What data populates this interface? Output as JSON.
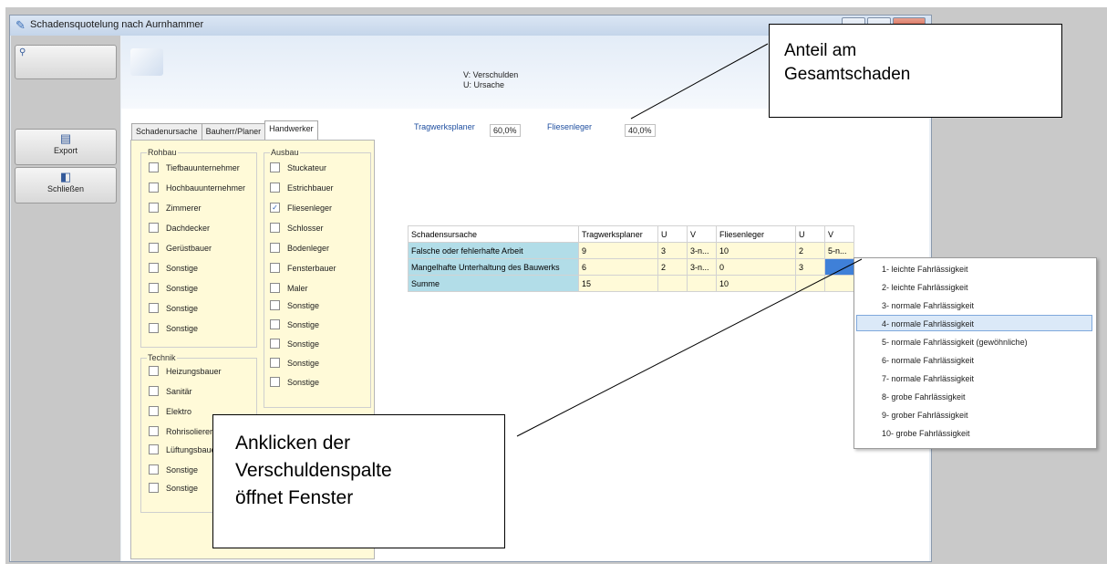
{
  "window": {
    "title": "Schadensquotelung nach Aurnhammer"
  },
  "sidebar": {
    "export_label": "Export",
    "close_label": "Schließen"
  },
  "header": {
    "legend_v": "V: Verschulden",
    "legend_u": "U: Ursache"
  },
  "tabs": [
    "Schadenursache",
    "Bauherr/Planer",
    "Handwerker"
  ],
  "groups": {
    "rohbau": {
      "title": "Rohbau",
      "items": [
        "Tiefbauunternehmer",
        "Hochbauunternehmer",
        "Zimmerer",
        "Dachdecker",
        "Gerüstbauer",
        "Sonstige",
        "Sonstige",
        "Sonstige",
        "Sonstige"
      ]
    },
    "ausbau": {
      "title": "Ausbau",
      "items": [
        "Stuckateur",
        "Estrichbauer",
        "Fliesenleger",
        "Schlosser",
        "Bodenleger",
        "Fensterbauer",
        "Maler",
        "Sonstige",
        "Sonstige",
        "Sonstige",
        "Sonstige",
        "Sonstige"
      ],
      "checked_index": 2
    },
    "technik": {
      "title": "Technik",
      "items": [
        "Heizungsbauer",
        "Sanitär",
        "Elektro",
        "Rohrisolierer",
        "Lüftungsbauer",
        "Sonstige",
        "Sonstige"
      ]
    }
  },
  "shares": [
    {
      "label": "Tragwerksplaner",
      "value": "60,0%"
    },
    {
      "label": "Fliesenleger",
      "value": "40,0%"
    }
  ],
  "table": {
    "headers": [
      "Schadensursache",
      "Tragwerksplaner",
      "U",
      "V",
      "Fliesenleger",
      "U",
      "V"
    ],
    "rows": [
      [
        "Falsche oder fehlerhafte Arbeit",
        "9",
        "3",
        "3-n...",
        "10",
        "2",
        "5-n..."
      ],
      [
        "Mangelhafte Unterhaltung des Bauwerks",
        "6",
        "2",
        "3-n...",
        "0",
        "3",
        ""
      ],
      [
        "Summe",
        "15",
        "",
        "",
        "10",
        "",
        ""
      ]
    ]
  },
  "dropdown": {
    "items": [
      "1- leichte Fahrlässigkeit",
      "2- leichte Fahrlässigkeit",
      "3- normale Fahrlässigkeit",
      "4- normale Fahrlässigkeit",
      "5- normale Fahrlässigkeit (gewöhnliche)",
      "6- normale Fahrlässigkeit",
      "7- normale Fahrlässigkeit",
      "8- grobe Fahrlässigkeit",
      "9- grober Fahrlässigkeit",
      "10- grobe Fahrlässigkeit"
    ],
    "highlighted_index": 3
  },
  "callouts": {
    "top": {
      "line1": "Anteil am",
      "line2": "Gesamtschaden"
    },
    "bottom": {
      "line1": "Anklicken der",
      "line2": "Verschuldenspalte",
      "line3": "öffnet Fenster"
    }
  }
}
